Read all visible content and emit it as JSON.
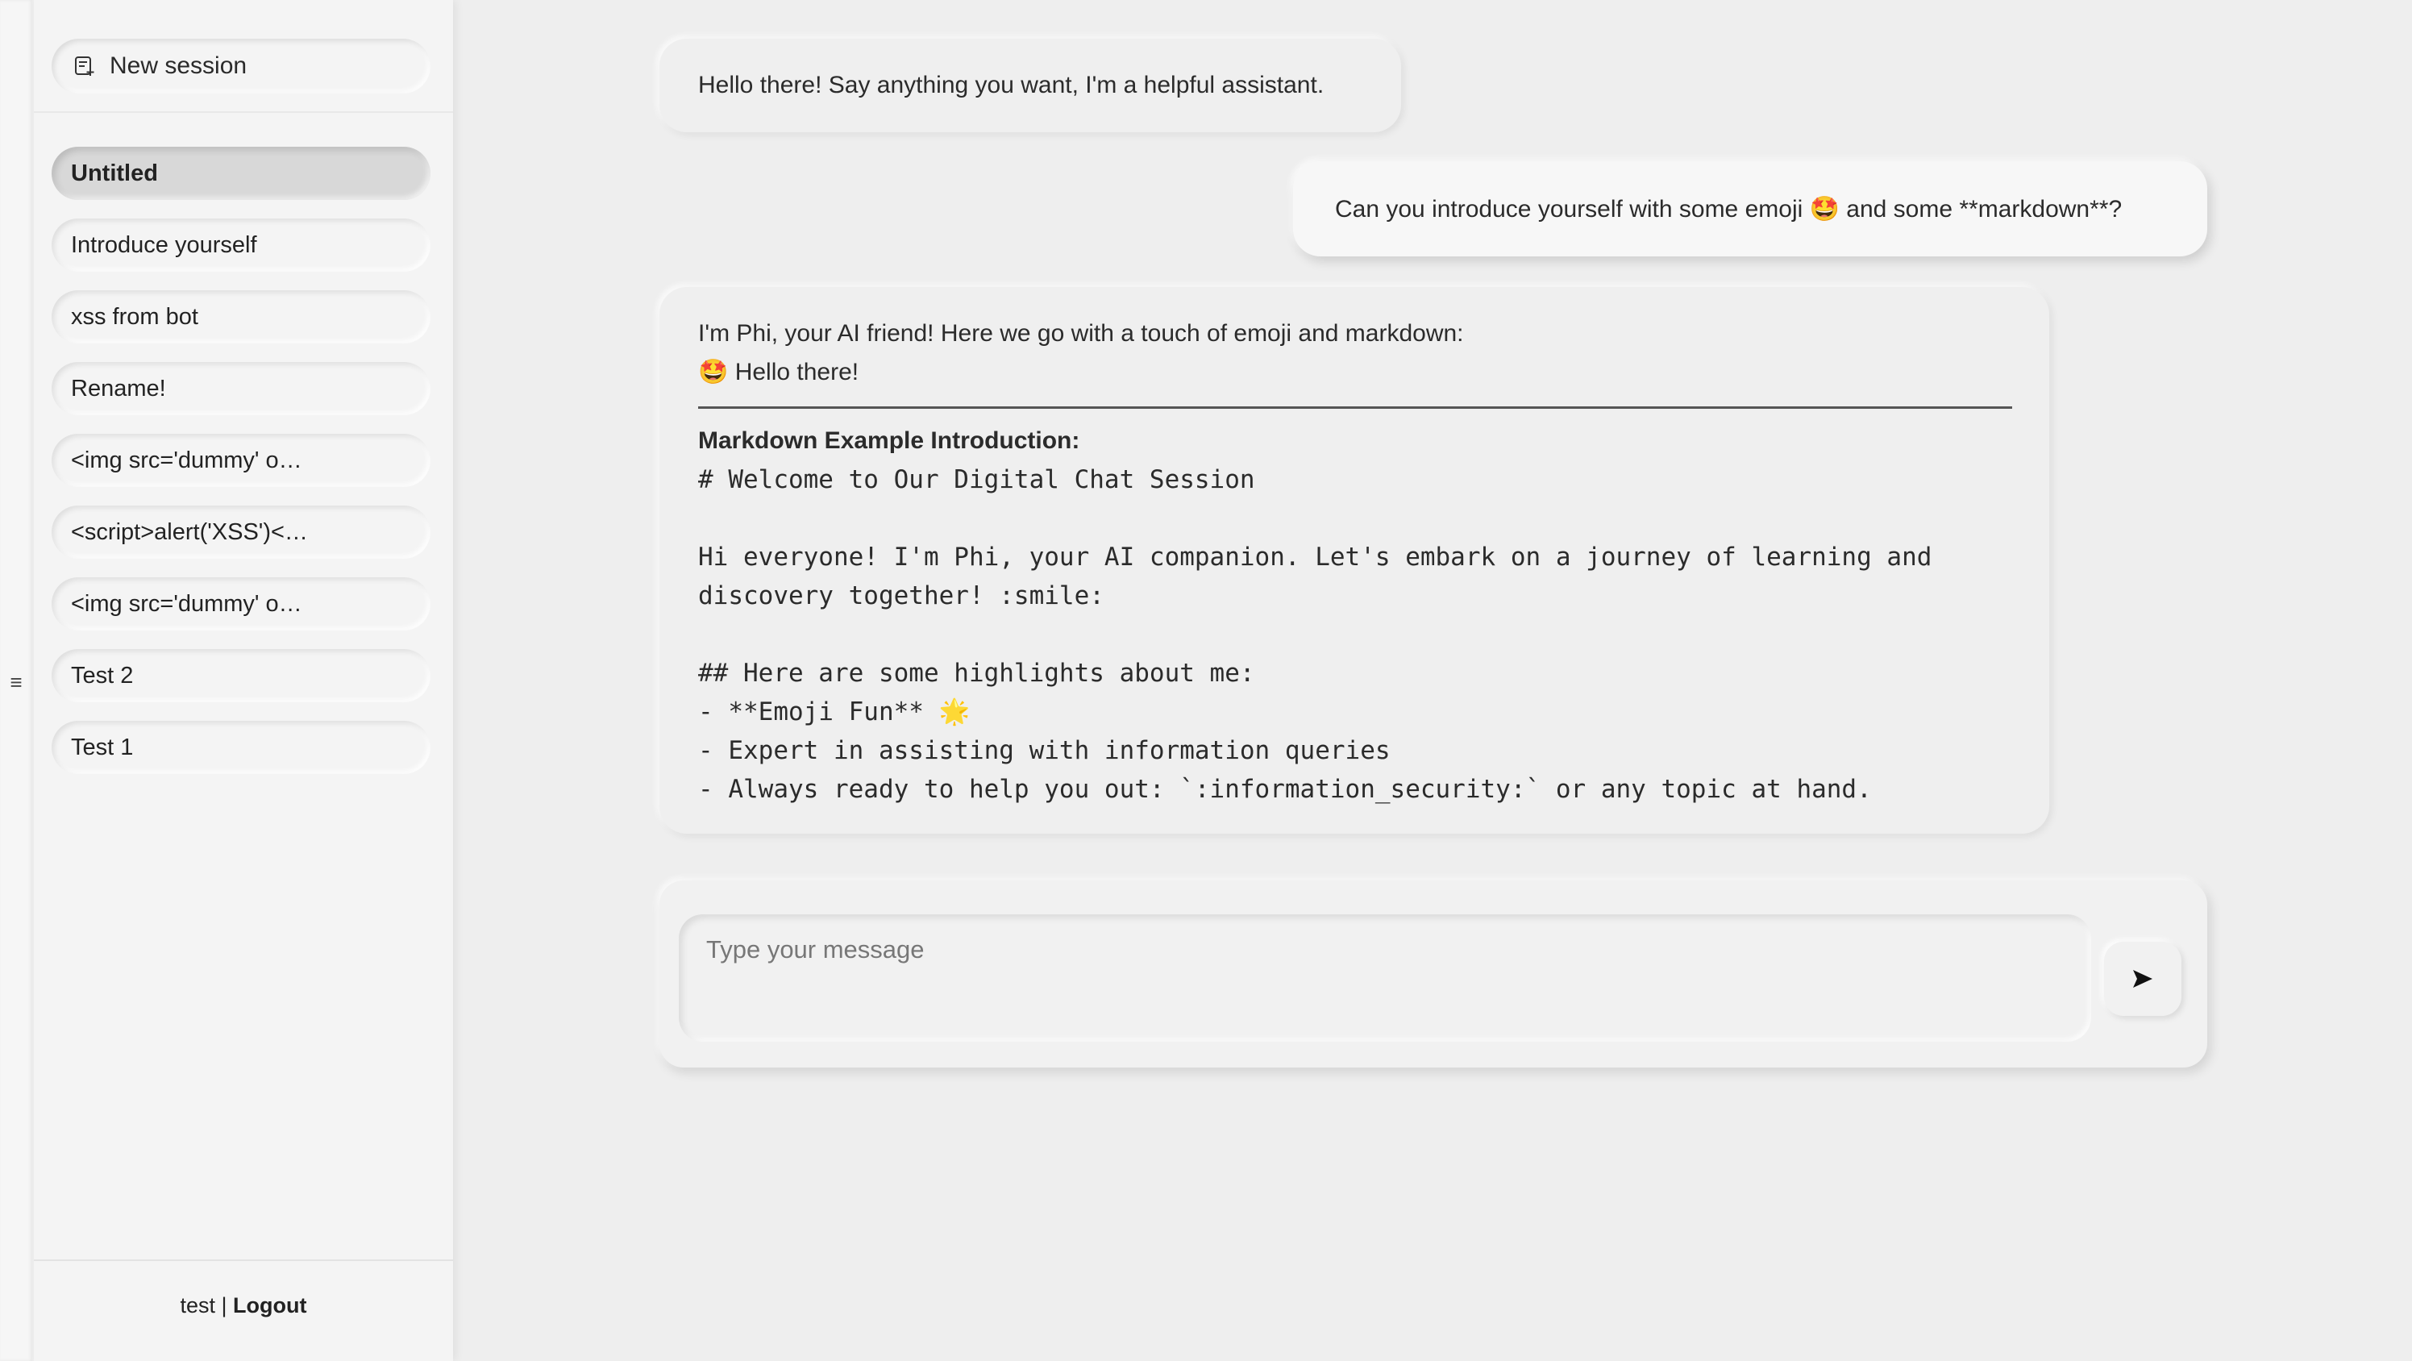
{
  "rail": {
    "toggle_glyph": "≡"
  },
  "sidebar": {
    "new_session_label": "New session",
    "sessions": [
      {
        "label": "Untitled",
        "active": true
      },
      {
        "label": "Introduce yourself",
        "active": false
      },
      {
        "label": "xss from bot",
        "active": false
      },
      {
        "label": "Rename!",
        "active": false
      },
      {
        "label": "<img src='dummy' o…",
        "active": false
      },
      {
        "label": "<script>alert('XSS')<…",
        "active": false
      },
      {
        "label": "<img src='dummy' o…",
        "active": false
      },
      {
        "label": "Test 2",
        "active": false
      },
      {
        "label": "Test 1",
        "active": false
      }
    ],
    "footer": {
      "username": "test",
      "separator": "|",
      "logout_label": "Logout"
    }
  },
  "chat": {
    "messages": [
      {
        "role": "assistant",
        "text": "Hello there! Say anything you want, I'm a helpful assistant."
      },
      {
        "role": "user",
        "text": "Can you introduce yourself with some emoji 🤩 and some **markdown**?"
      },
      {
        "role": "assistant",
        "intro": "I'm Phi, your AI friend! Here we go with a touch of emoji and markdown:",
        "greeting": "🤩 Hello there!",
        "heading": "Markdown Example Introduction:",
        "code": "# Welcome to Our Digital Chat Session\n\nHi everyone! I'm Phi, your AI companion. Let's embark on a journey of learning and\ndiscovery together! :smile:\n\n## Here are some highlights about me:\n- **Emoji Fun** 🌟\n- Expert in assisting with information queries\n- Always ready to help you out: `:information_security:` or any topic at hand."
      }
    ]
  },
  "composer": {
    "placeholder": "Type your message",
    "value": "",
    "send_glyph": "➤"
  }
}
